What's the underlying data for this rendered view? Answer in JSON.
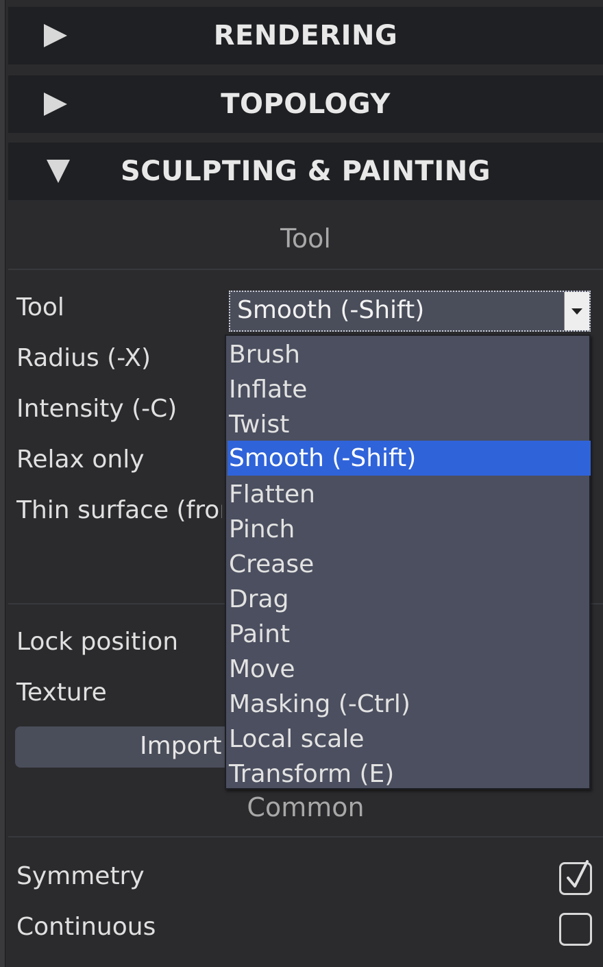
{
  "sections": {
    "rendering": "RENDERING",
    "topology": "TOPOLOGY",
    "sculpting": "SCULPTING & PAINTING"
  },
  "tool_group_title": "Tool",
  "labels": {
    "tool": "Tool",
    "radius": "Radius (-X)",
    "intensity": "Intensity (-C)",
    "relax_only": "Relax only",
    "thin_surface": "Thin surface (front vertex only)",
    "lock_position": "Lock position",
    "texture": "Texture"
  },
  "tool_select": {
    "selected": "Smooth (-Shift)",
    "options": [
      "Brush",
      "Inflate",
      "Twist",
      "Smooth (-Shift)",
      "Flatten",
      "Pinch",
      "Crease",
      "Drag",
      "Paint",
      "Move",
      "Masking (-Ctrl)",
      "Local scale",
      "Transform (E)"
    ]
  },
  "import_button": "Import",
  "common_group_title": "Common",
  "common": {
    "symmetry": "Symmetry",
    "symmetry_checked": true,
    "continuous": "Continuous",
    "continuous_checked": false
  },
  "colors": {
    "panel_bg": "#2b2b2e",
    "header_bg": "#1f2023",
    "select_bg": "#4a4d5a",
    "highlight": "#2f63d9"
  }
}
